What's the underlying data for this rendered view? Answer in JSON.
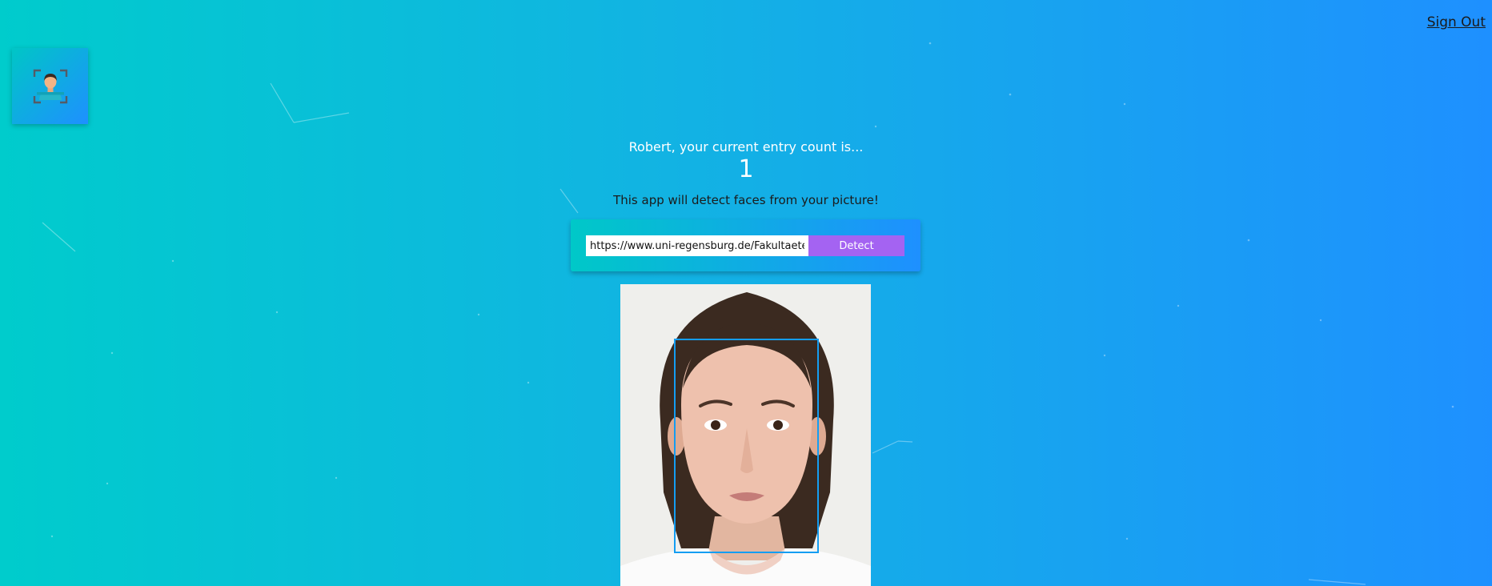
{
  "nav": {
    "sign_out_label": "Sign Out"
  },
  "logo": {
    "icon": "face-recognition-icon"
  },
  "rank": {
    "label": "Robert, your current entry count is...",
    "count": "1"
  },
  "tagline": "This app will detect faces from your picture!",
  "form": {
    "url_value": "https://www.uni-regensburg.de/Fakultaeten/phil",
    "detect_label": "Detect"
  },
  "result": {
    "image_alt": "face photo",
    "face_count": 1
  },
  "colors": {
    "gradient_start": "#00cccc",
    "gradient_end": "#1e90ff",
    "button": "#a463f2",
    "bounding_box": "#149df2"
  }
}
